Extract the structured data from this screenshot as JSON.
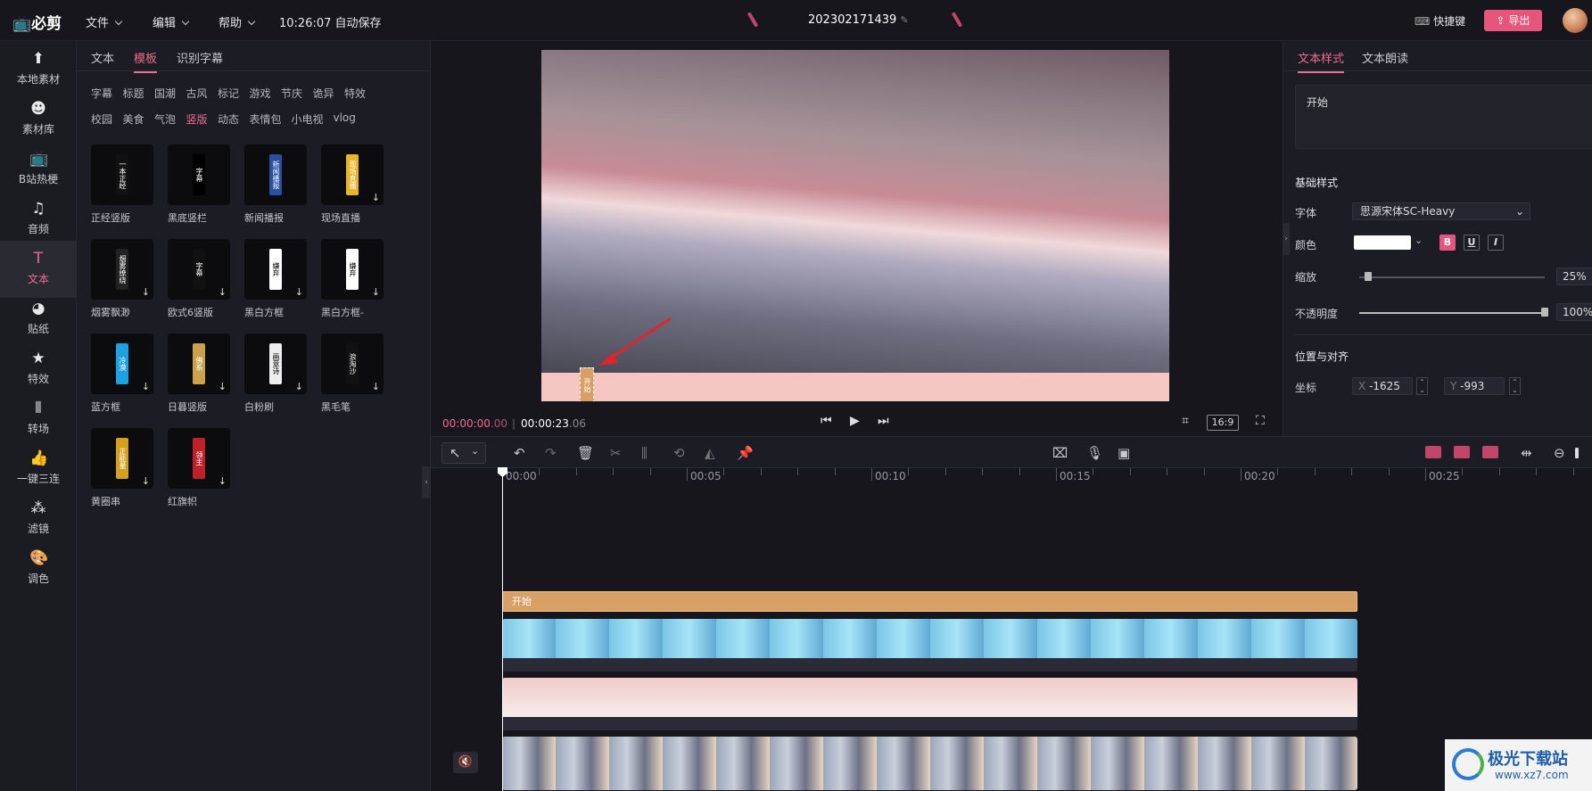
{
  "topbar": {
    "logo": "必剪",
    "menus": [
      "文件",
      "编辑",
      "帮助"
    ],
    "autosave": "10:26:07 自动保存",
    "project_name": "202302171439",
    "shortcut_label": "快捷键",
    "export_label": "导出"
  },
  "left_nav": [
    {
      "label": "本地素材",
      "icon": "upload-folder-icon"
    },
    {
      "label": "素材库",
      "icon": "material-library-icon"
    },
    {
      "label": "B站热梗",
      "icon": "bilibili-tv-icon"
    },
    {
      "label": "音频",
      "icon": "music-note-icon"
    },
    {
      "label": "文本",
      "icon": "text-T-icon",
      "active": true
    },
    {
      "label": "贴纸",
      "icon": "sticker-icon"
    },
    {
      "label": "特效",
      "icon": "effects-star-icon"
    },
    {
      "label": "转场",
      "icon": "transition-icon"
    },
    {
      "label": "一键三连",
      "icon": "thumbs-up-icon"
    },
    {
      "label": "滤镜",
      "icon": "filter-circles-icon"
    },
    {
      "label": "调色",
      "icon": "palette-icon"
    }
  ],
  "library": {
    "tabs": [
      "文本",
      "模板",
      "识别字幕"
    ],
    "active_tab": "模板",
    "categories_row1": [
      "字幕",
      "标题",
      "国潮",
      "古风",
      "标记",
      "游戏",
      "节庆",
      "诡异",
      "特效"
    ],
    "categories_row2": [
      "校园",
      "美食",
      "气泡",
      "竖版",
      "动态",
      "表情包",
      "小电视",
      "vlog"
    ],
    "active_category": "竖版",
    "templates": [
      {
        "label": "正经竖版",
        "card_text": "一本正经"
      },
      {
        "label": "黑底竖栏",
        "card_text": "字幕"
      },
      {
        "label": "新闻播报",
        "card_text": "新闻播报"
      },
      {
        "label": "现场直播",
        "card_text": "现场直播"
      },
      {
        "label": "烟雾飘渺",
        "card_text": "烟雾缭绕"
      },
      {
        "label": "欧式6竖版",
        "card_text": "字幕"
      },
      {
        "label": "黑白方框",
        "card_text": "嫌弃"
      },
      {
        "label": "黑白方框-",
        "card_text": "嫌弃"
      },
      {
        "label": "蓝方框",
        "card_text": "冷漠"
      },
      {
        "label": "日暮竖版",
        "card_text": "佛系"
      },
      {
        "label": "白粉刷",
        "card_text": "画意诗"
      },
      {
        "label": "黑毛笔",
        "card_text": "浪淘沙"
      },
      {
        "label": "黄圈串",
        "card_text": "正能量"
      },
      {
        "label": "红旗帜",
        "card_text": "领主"
      }
    ]
  },
  "preview": {
    "overlay_text": "开始",
    "current_time": "00:00:00",
    "current_frames": ".00",
    "total_time": "00:00:23",
    "total_frames": ".06",
    "aspect_ratio": "16:9"
  },
  "right_panel": {
    "tabs": [
      "文本样式",
      "文本朗读"
    ],
    "active_tab": "文本样式",
    "text_content": "开始",
    "section_basic": "基础样式",
    "font_label": "字体",
    "font_value": "思源宋体SC-Heavy",
    "color_label": "颜色",
    "color_value": "#ffffff",
    "bold": "B",
    "underline": "U",
    "italic": "I",
    "scale_label": "缩放",
    "scale_value": "25%",
    "scale_fraction": 0.05,
    "opacity_label": "不透明度",
    "opacity_value": "100%",
    "opacity_fraction": 1.0,
    "section_position": "位置与对齐",
    "coord_label": "坐标",
    "x_prefix": "X",
    "x_value": "-1625",
    "y_prefix": "Y",
    "y_value": "-993"
  },
  "timeline": {
    "ruler_labels": [
      "00:00",
      "00:05",
      "00:10",
      "00:15",
      "00:20",
      "00:25"
    ],
    "text_clip_label": "开始"
  },
  "watermark": {
    "title": "极光下载站",
    "url": "www.xz7.com"
  },
  "colors": {
    "accent": "#ef6b8f",
    "export_button": "#e8557c",
    "text_clip": "#d9a066",
    "panel_bg": "#1c1c24"
  }
}
